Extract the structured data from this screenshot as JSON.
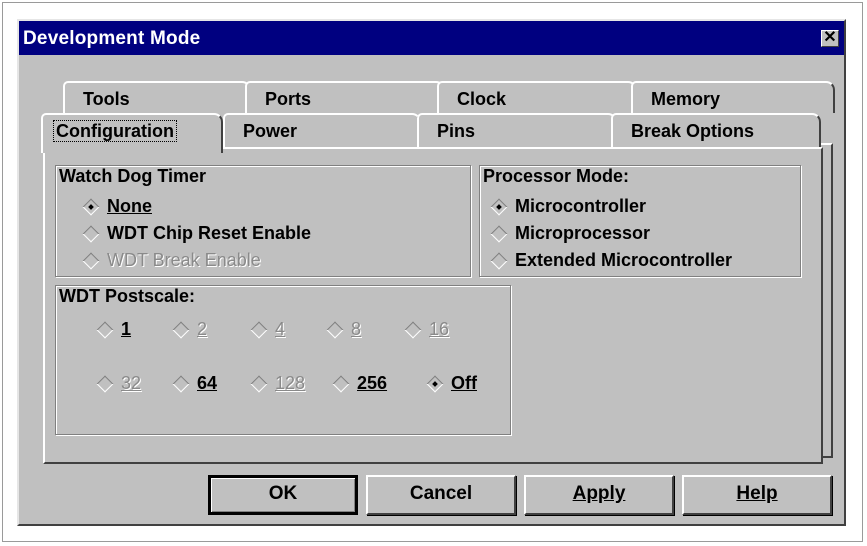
{
  "window": {
    "title": "Development Mode",
    "close_glyph": "✕"
  },
  "tabs_back": [
    "Tools",
    "Ports",
    "Clock",
    "Memory"
  ],
  "tabs_front": [
    "Configuration",
    "Power",
    "Pins",
    "Break Options"
  ],
  "active_tab": "Configuration",
  "watchdog": {
    "title": "Watch Dog Timer",
    "options": [
      {
        "label": "None",
        "selected": true,
        "enabled": true
      },
      {
        "label": "WDT Chip Reset Enable",
        "selected": false,
        "enabled": true
      },
      {
        "label": "WDT Break Enable",
        "selected": false,
        "enabled": false
      }
    ]
  },
  "processor_mode": {
    "title": "Processor Mode:",
    "options": [
      {
        "label": "Microcontroller",
        "selected": true
      },
      {
        "label": "Microprocessor",
        "selected": false
      },
      {
        "label": "Extended Microcontroller",
        "selected": false
      }
    ]
  },
  "postscale": {
    "title": "WDT Postscale:",
    "options": [
      {
        "label": "1",
        "selected": false,
        "enabled": true
      },
      {
        "label": "2",
        "selected": false,
        "enabled": false
      },
      {
        "label": "4",
        "selected": false,
        "enabled": false
      },
      {
        "label": "8",
        "selected": false,
        "enabled": false
      },
      {
        "label": "16",
        "selected": false,
        "enabled": false
      },
      {
        "label": "32",
        "selected": false,
        "enabled": false
      },
      {
        "label": "64",
        "selected": false,
        "enabled": true
      },
      {
        "label": "128",
        "selected": false,
        "enabled": false
      },
      {
        "label": "256",
        "selected": false,
        "enabled": true
      },
      {
        "label": "Off",
        "selected": true,
        "enabled": true
      }
    ]
  },
  "buttons": {
    "ok": "OK",
    "cancel": "Cancel",
    "apply": "Apply",
    "help": "Help"
  }
}
